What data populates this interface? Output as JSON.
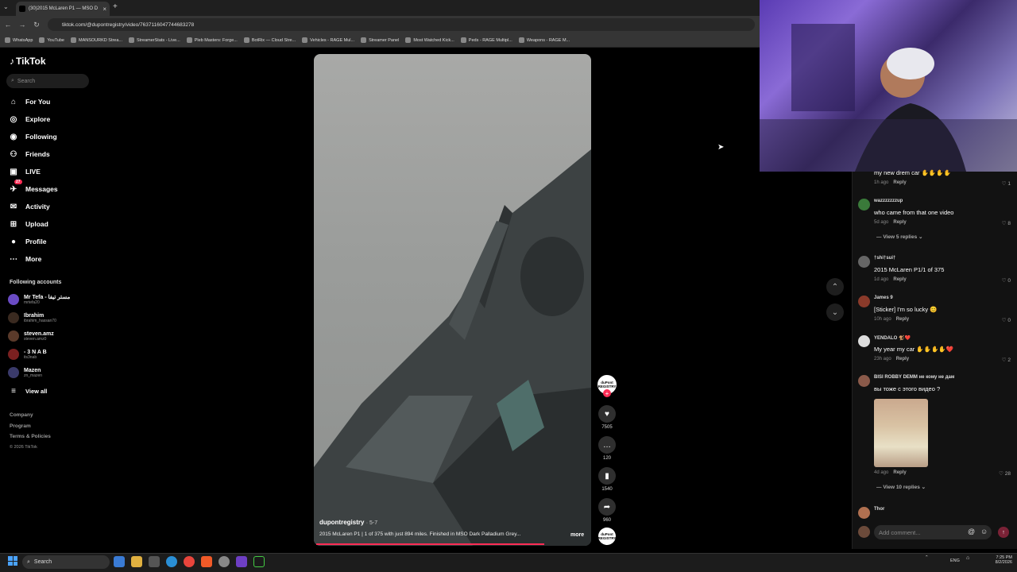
{
  "browser": {
    "tab_title": "(30)2015 McLaren P1 — MSO D",
    "url": "tiktok.com/@dupontregistry/video/7637116047744683278",
    "bookmarks": [
      "WhatsApp",
      "YouTube",
      "MANSOURKD Strea...",
      "StreamerStats - Live...",
      "Pleb Masters: Forge...",
      "BotRix — Cloud Stre...",
      "Vehicles - RAGE Mul...",
      "Streamer Panel",
      "Most Watched Kick...",
      "Peds - RAGE Multipl...",
      "Weapons - RAGE M..."
    ]
  },
  "sidebar": {
    "logo": "TikTok",
    "search_placeholder": "Search",
    "nav": [
      {
        "label": "For You",
        "icon": "home-icon"
      },
      {
        "label": "Explore",
        "icon": "compass-icon"
      },
      {
        "label": "Following",
        "icon": "following-icon"
      },
      {
        "label": "Friends",
        "icon": "friends-icon"
      },
      {
        "label": "LIVE",
        "icon": "live-icon"
      },
      {
        "label": "Messages",
        "icon": "messages-icon",
        "badge": "27"
      },
      {
        "label": "Activity",
        "icon": "activity-icon"
      },
      {
        "label": "Upload",
        "icon": "upload-icon"
      },
      {
        "label": "Profile",
        "icon": "profile-icon"
      },
      {
        "label": "More",
        "icon": "more-icon"
      }
    ],
    "following_title": "Following accounts",
    "accounts": [
      {
        "name": "Mr Tefa - مستر تيفا",
        "handle": "mrtefa20"
      },
      {
        "name": "Ibrahim",
        "handle": "ibrahim_hassan70"
      },
      {
        "name": "steven.amz",
        "handle": "steven.amz0"
      },
      {
        "name": "- 3 N A B",
        "handle": "its3nab"
      },
      {
        "name": "Mazen",
        "handle": "zn_mazen"
      }
    ],
    "view_all": "View all",
    "footer": [
      "Company",
      "Program",
      "Terms & Policies",
      "© 2026 TikTok"
    ]
  },
  "video": {
    "username": "dupontregistry",
    "date": "5-7",
    "description": "2015 McLaren P1 | 1 of 375 with just 894 miles. Finished in MSO Dark Palladium Grey...",
    "more": "more",
    "creator_avatar_text": "duPont REGISTRY",
    "likes": "7505",
    "comments": "120",
    "saves": "1540",
    "shares": "960",
    "progress": 0.83
  },
  "comments": [
    {
      "name": "",
      "text": "my new drem car ✋✋✋✋",
      "time": "1h ago",
      "reply": "Reply",
      "likes": "1"
    },
    {
      "name": "wazzzzzzzup",
      "text": "who came from that one video",
      "time": "5d ago",
      "reply": "Reply",
      "likes": "8",
      "replies": "View 5 replies"
    },
    {
      "name": "†shi†sui†",
      "text": "2015 McLaren P1/1 of 375",
      "time": "1d ago",
      "reply": "Reply",
      "likes": "0"
    },
    {
      "name": "James 9",
      "text": "[Sticker] I'm so lucky 😊",
      "time": "10h ago",
      "reply": "Reply",
      "likes": "0"
    },
    {
      "name": "YENDALO 🐒❤️",
      "text": "My year my car ✋✋✋✋❤️",
      "time": "23h ago",
      "reply": "Reply",
      "likes": "2"
    },
    {
      "name": "BISI ROBBY DEMM не кому не дам",
      "text": "вы тоже с этого видео ?",
      "time": "4d ago",
      "reply": "Reply",
      "likes": "28",
      "replies": "View 10 replies"
    },
    {
      "name": "Thor",
      "text": "",
      "time": "",
      "reply": "",
      "likes": ""
    }
  ],
  "comment_input_placeholder": "Add comment...",
  "taskbar": {
    "search": "Search",
    "lang": "ENG",
    "time": "7:25 PM",
    "date": "8/2/2026"
  }
}
